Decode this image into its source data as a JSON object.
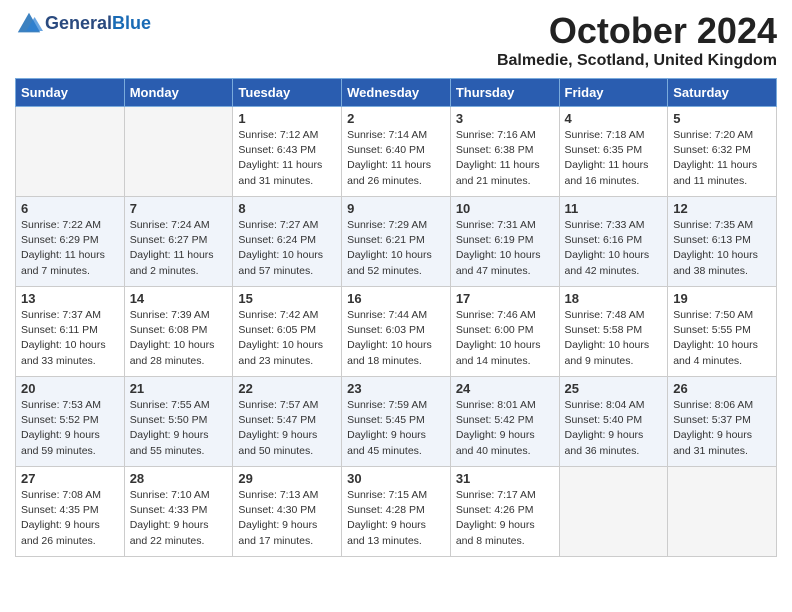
{
  "logo": {
    "line1": "General",
    "line2": "Blue"
  },
  "title": "October 2024",
  "subtitle": "Balmedie, Scotland, United Kingdom",
  "weekdays": [
    "Sunday",
    "Monday",
    "Tuesday",
    "Wednesday",
    "Thursday",
    "Friday",
    "Saturday"
  ],
  "weeks": [
    [
      {
        "day": "",
        "sunrise": "",
        "sunset": "",
        "daylight": ""
      },
      {
        "day": "",
        "sunrise": "",
        "sunset": "",
        "daylight": ""
      },
      {
        "day": "1",
        "sunrise": "Sunrise: 7:12 AM",
        "sunset": "Sunset: 6:43 PM",
        "daylight": "Daylight: 11 hours and 31 minutes."
      },
      {
        "day": "2",
        "sunrise": "Sunrise: 7:14 AM",
        "sunset": "Sunset: 6:40 PM",
        "daylight": "Daylight: 11 hours and 26 minutes."
      },
      {
        "day": "3",
        "sunrise": "Sunrise: 7:16 AM",
        "sunset": "Sunset: 6:38 PM",
        "daylight": "Daylight: 11 hours and 21 minutes."
      },
      {
        "day": "4",
        "sunrise": "Sunrise: 7:18 AM",
        "sunset": "Sunset: 6:35 PM",
        "daylight": "Daylight: 11 hours and 16 minutes."
      },
      {
        "day": "5",
        "sunrise": "Sunrise: 7:20 AM",
        "sunset": "Sunset: 6:32 PM",
        "daylight": "Daylight: 11 hours and 11 minutes."
      }
    ],
    [
      {
        "day": "6",
        "sunrise": "Sunrise: 7:22 AM",
        "sunset": "Sunset: 6:29 PM",
        "daylight": "Daylight: 11 hours and 7 minutes."
      },
      {
        "day": "7",
        "sunrise": "Sunrise: 7:24 AM",
        "sunset": "Sunset: 6:27 PM",
        "daylight": "Daylight: 11 hours and 2 minutes."
      },
      {
        "day": "8",
        "sunrise": "Sunrise: 7:27 AM",
        "sunset": "Sunset: 6:24 PM",
        "daylight": "Daylight: 10 hours and 57 minutes."
      },
      {
        "day": "9",
        "sunrise": "Sunrise: 7:29 AM",
        "sunset": "Sunset: 6:21 PM",
        "daylight": "Daylight: 10 hours and 52 minutes."
      },
      {
        "day": "10",
        "sunrise": "Sunrise: 7:31 AM",
        "sunset": "Sunset: 6:19 PM",
        "daylight": "Daylight: 10 hours and 47 minutes."
      },
      {
        "day": "11",
        "sunrise": "Sunrise: 7:33 AM",
        "sunset": "Sunset: 6:16 PM",
        "daylight": "Daylight: 10 hours and 42 minutes."
      },
      {
        "day": "12",
        "sunrise": "Sunrise: 7:35 AM",
        "sunset": "Sunset: 6:13 PM",
        "daylight": "Daylight: 10 hours and 38 minutes."
      }
    ],
    [
      {
        "day": "13",
        "sunrise": "Sunrise: 7:37 AM",
        "sunset": "Sunset: 6:11 PM",
        "daylight": "Daylight: 10 hours and 33 minutes."
      },
      {
        "day": "14",
        "sunrise": "Sunrise: 7:39 AM",
        "sunset": "Sunset: 6:08 PM",
        "daylight": "Daylight: 10 hours and 28 minutes."
      },
      {
        "day": "15",
        "sunrise": "Sunrise: 7:42 AM",
        "sunset": "Sunset: 6:05 PM",
        "daylight": "Daylight: 10 hours and 23 minutes."
      },
      {
        "day": "16",
        "sunrise": "Sunrise: 7:44 AM",
        "sunset": "Sunset: 6:03 PM",
        "daylight": "Daylight: 10 hours and 18 minutes."
      },
      {
        "day": "17",
        "sunrise": "Sunrise: 7:46 AM",
        "sunset": "Sunset: 6:00 PM",
        "daylight": "Daylight: 10 hours and 14 minutes."
      },
      {
        "day": "18",
        "sunrise": "Sunrise: 7:48 AM",
        "sunset": "Sunset: 5:58 PM",
        "daylight": "Daylight: 10 hours and 9 minutes."
      },
      {
        "day": "19",
        "sunrise": "Sunrise: 7:50 AM",
        "sunset": "Sunset: 5:55 PM",
        "daylight": "Daylight: 10 hours and 4 minutes."
      }
    ],
    [
      {
        "day": "20",
        "sunrise": "Sunrise: 7:53 AM",
        "sunset": "Sunset: 5:52 PM",
        "daylight": "Daylight: 9 hours and 59 minutes."
      },
      {
        "day": "21",
        "sunrise": "Sunrise: 7:55 AM",
        "sunset": "Sunset: 5:50 PM",
        "daylight": "Daylight: 9 hours and 55 minutes."
      },
      {
        "day": "22",
        "sunrise": "Sunrise: 7:57 AM",
        "sunset": "Sunset: 5:47 PM",
        "daylight": "Daylight: 9 hours and 50 minutes."
      },
      {
        "day": "23",
        "sunrise": "Sunrise: 7:59 AM",
        "sunset": "Sunset: 5:45 PM",
        "daylight": "Daylight: 9 hours and 45 minutes."
      },
      {
        "day": "24",
        "sunrise": "Sunrise: 8:01 AM",
        "sunset": "Sunset: 5:42 PM",
        "daylight": "Daylight: 9 hours and 40 minutes."
      },
      {
        "day": "25",
        "sunrise": "Sunrise: 8:04 AM",
        "sunset": "Sunset: 5:40 PM",
        "daylight": "Daylight: 9 hours and 36 minutes."
      },
      {
        "day": "26",
        "sunrise": "Sunrise: 8:06 AM",
        "sunset": "Sunset: 5:37 PM",
        "daylight": "Daylight: 9 hours and 31 minutes."
      }
    ],
    [
      {
        "day": "27",
        "sunrise": "Sunrise: 7:08 AM",
        "sunset": "Sunset: 4:35 PM",
        "daylight": "Daylight: 9 hours and 26 minutes."
      },
      {
        "day": "28",
        "sunrise": "Sunrise: 7:10 AM",
        "sunset": "Sunset: 4:33 PM",
        "daylight": "Daylight: 9 hours and 22 minutes."
      },
      {
        "day": "29",
        "sunrise": "Sunrise: 7:13 AM",
        "sunset": "Sunset: 4:30 PM",
        "daylight": "Daylight: 9 hours and 17 minutes."
      },
      {
        "day": "30",
        "sunrise": "Sunrise: 7:15 AM",
        "sunset": "Sunset: 4:28 PM",
        "daylight": "Daylight: 9 hours and 13 minutes."
      },
      {
        "day": "31",
        "sunrise": "Sunrise: 7:17 AM",
        "sunset": "Sunset: 4:26 PM",
        "daylight": "Daylight: 9 hours and 8 minutes."
      },
      {
        "day": "",
        "sunrise": "",
        "sunset": "",
        "daylight": ""
      },
      {
        "day": "",
        "sunrise": "",
        "sunset": "",
        "daylight": ""
      }
    ]
  ]
}
